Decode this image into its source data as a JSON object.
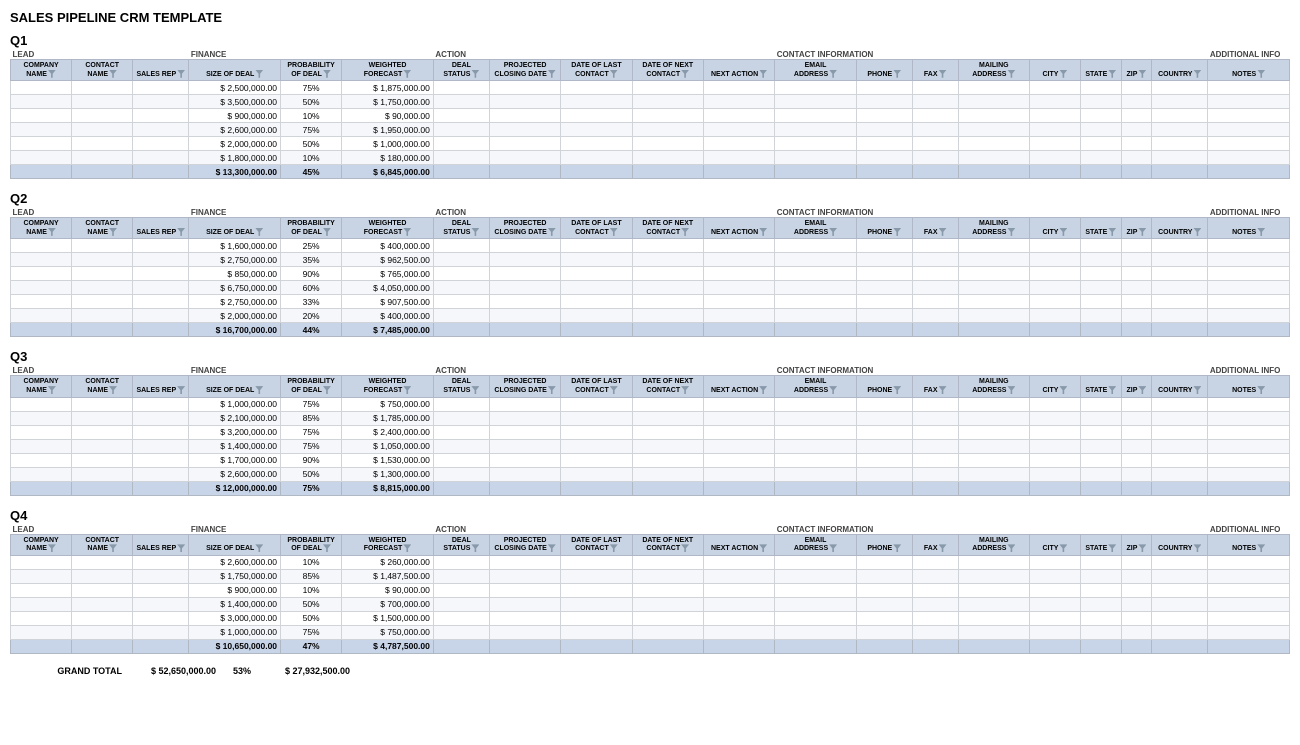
{
  "page": {
    "title": "SALES PIPELINE CRM TEMPLATE"
  },
  "columns": {
    "group_headers": [
      {
        "label": "LEAD",
        "colspan": 3
      },
      {
        "label": "FINANCE",
        "colspan": 3
      },
      {
        "label": "ACTION",
        "colspan": 4
      },
      {
        "label": "CONTACT INFORMATION",
        "colspan": 7
      },
      {
        "label": "ADDITIONAL INFO",
        "colspan": 2
      }
    ],
    "col_headers": [
      "COMPANY NAME",
      "CONTACT NAME",
      "SALES REP",
      "SIZE OF DEAL",
      "PROBABILITY OF DEAL",
      "WEIGHTED FORECAST",
      "DEAL STATUS",
      "PROJECTED CLOSING DATE",
      "DATE OF LAST CONTACT",
      "DATE OF NEXT CONTACT",
      "NEXT ACTION",
      "EMAIL ADDRESS",
      "PHONE",
      "FAX",
      "MAILING ADDRESS",
      "CITY",
      "STATE",
      "ZIP",
      "COUNTRY",
      "NOTES"
    ]
  },
  "quarters": [
    {
      "label": "Q1",
      "rows": [
        {
          "size": "$ 2,500,000.00",
          "prob": "75%",
          "weighted": "$ 1,875,000.00"
        },
        {
          "size": "$ 3,500,000.00",
          "prob": "50%",
          "weighted": "$ 1,750,000.00"
        },
        {
          "size": "$ 900,000.00",
          "prob": "10%",
          "weighted": "$ 90,000.00"
        },
        {
          "size": "$ 2,600,000.00",
          "prob": "75%",
          "weighted": "$ 1,950,000.00"
        },
        {
          "size": "$ 2,000,000.00",
          "prob": "50%",
          "weighted": "$ 1,000,000.00"
        },
        {
          "size": "$ 1,800,000.00",
          "prob": "10%",
          "weighted": "$ 180,000.00"
        }
      ],
      "total": {
        "size": "$ 13,300,000.00",
        "prob": "45%",
        "weighted": "$ 6,845,000.00"
      }
    },
    {
      "label": "Q2",
      "rows": [
        {
          "size": "$ 1,600,000.00",
          "prob": "25%",
          "weighted": "$ 400,000.00"
        },
        {
          "size": "$ 2,750,000.00",
          "prob": "35%",
          "weighted": "$ 962,500.00"
        },
        {
          "size": "$ 850,000.00",
          "prob": "90%",
          "weighted": "$ 765,000.00"
        },
        {
          "size": "$ 6,750,000.00",
          "prob": "60%",
          "weighted": "$ 4,050,000.00"
        },
        {
          "size": "$ 2,750,000.00",
          "prob": "33%",
          "weighted": "$ 907,500.00"
        },
        {
          "size": "$ 2,000,000.00",
          "prob": "20%",
          "weighted": "$ 400,000.00"
        }
      ],
      "total": {
        "size": "$ 16,700,000.00",
        "prob": "44%",
        "weighted": "$ 7,485,000.00"
      }
    },
    {
      "label": "Q3",
      "rows": [
        {
          "size": "$ 1,000,000.00",
          "prob": "75%",
          "weighted": "$ 750,000.00"
        },
        {
          "size": "$ 2,100,000.00",
          "prob": "85%",
          "weighted": "$ 1,785,000.00"
        },
        {
          "size": "$ 3,200,000.00",
          "prob": "75%",
          "weighted": "$ 2,400,000.00"
        },
        {
          "size": "$ 1,400,000.00",
          "prob": "75%",
          "weighted": "$ 1,050,000.00"
        },
        {
          "size": "$ 1,700,000.00",
          "prob": "90%",
          "weighted": "$ 1,530,000.00"
        },
        {
          "size": "$ 2,600,000.00",
          "prob": "50%",
          "weighted": "$ 1,300,000.00"
        }
      ],
      "total": {
        "size": "$ 12,000,000.00",
        "prob": "75%",
        "weighted": "$ 8,815,000.00"
      }
    },
    {
      "label": "Q4",
      "rows": [
        {
          "size": "$ 2,600,000.00",
          "prob": "10%",
          "weighted": "$ 260,000.00"
        },
        {
          "size": "$ 1,750,000.00",
          "prob": "85%",
          "weighted": "$ 1,487,500.00"
        },
        {
          "size": "$ 900,000.00",
          "prob": "10%",
          "weighted": "$ 90,000.00"
        },
        {
          "size": "$ 1,400,000.00",
          "prob": "50%",
          "weighted": "$ 700,000.00"
        },
        {
          "size": "$ 3,000,000.00",
          "prob": "50%",
          "weighted": "$ 1,500,000.00"
        },
        {
          "size": "$ 1,000,000.00",
          "prob": "75%",
          "weighted": "$ 750,000.00"
        }
      ],
      "total": {
        "size": "$ 10,650,000.00",
        "prob": "47%",
        "weighted": "$ 4,787,500.00"
      }
    }
  ],
  "grand_total": {
    "label": "GRAND TOTAL",
    "size": "$ 52,650,000.00",
    "prob": "53%",
    "weighted": "$ 27,932,500.00"
  }
}
